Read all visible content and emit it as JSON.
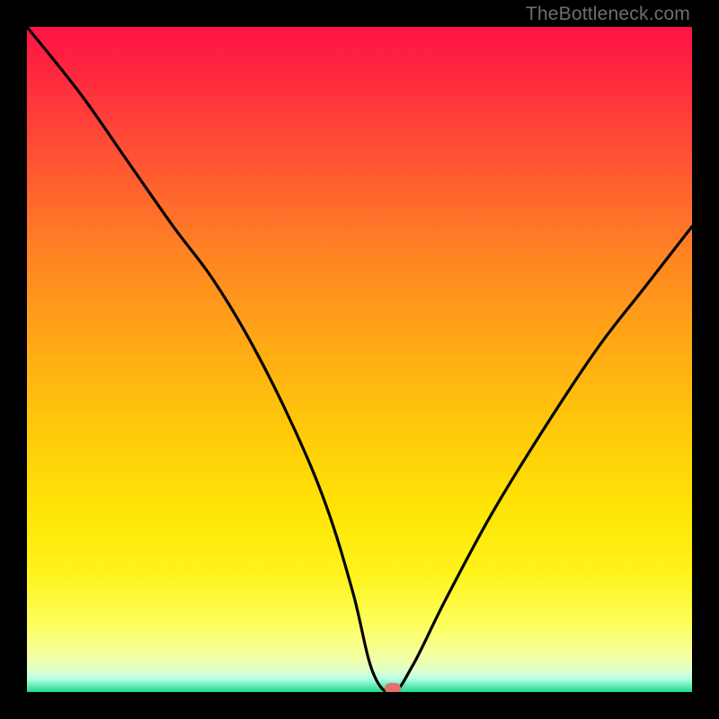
{
  "watermark": "TheBottleneck.com",
  "colors": {
    "frame": "#000000",
    "curve": "#000000",
    "marker": "#e46f69"
  },
  "chart_data": {
    "type": "line",
    "title": "",
    "xlabel": "",
    "ylabel": "",
    "xlim": [
      0,
      100
    ],
    "ylim": [
      0,
      100
    ],
    "grid": false,
    "legend": false,
    "annotations": [
      {
        "text": "TheBottleneck.com",
        "position": "top-right"
      }
    ],
    "marker": {
      "x": 55,
      "y": 0
    },
    "series": [
      {
        "name": "bottleneck-curve",
        "x": [
          0,
          8,
          15,
          22,
          28,
          34,
          40,
          45,
          49,
          52,
          55,
          58,
          63,
          70,
          78,
          86,
          93,
          100
        ],
        "values": [
          100,
          90,
          80,
          70,
          62,
          52,
          40,
          28,
          15,
          3,
          0,
          4,
          14,
          27,
          40,
          52,
          61,
          70
        ]
      }
    ]
  }
}
